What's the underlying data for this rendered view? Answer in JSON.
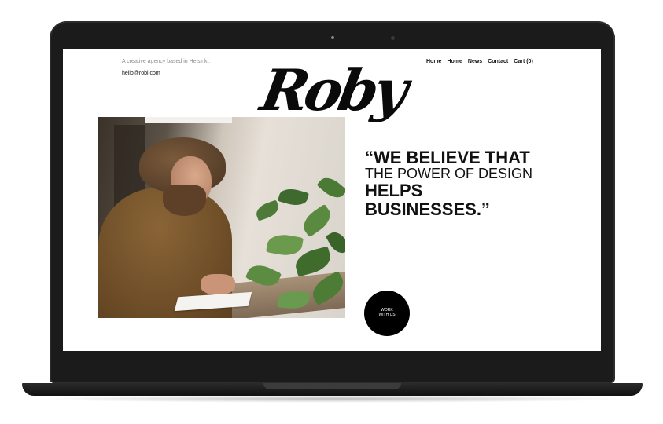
{
  "site": {
    "tagline": "A creative agency based in Helsinki.",
    "email": "hello@robi.com",
    "logo": "Roby"
  },
  "nav": {
    "items": [
      {
        "label": "Home"
      },
      {
        "label": "Home"
      },
      {
        "label": "News"
      },
      {
        "label": "Contact"
      },
      {
        "label": "Cart (0)"
      }
    ]
  },
  "hero": {
    "quote_line1": "“WE BELIEVE THAT",
    "quote_line2": "THE POWER OF DESIGN",
    "quote_line3": "HELPS BUSINESSES.”",
    "cta_line1": "WORK",
    "cta_line2": "WITH US"
  }
}
